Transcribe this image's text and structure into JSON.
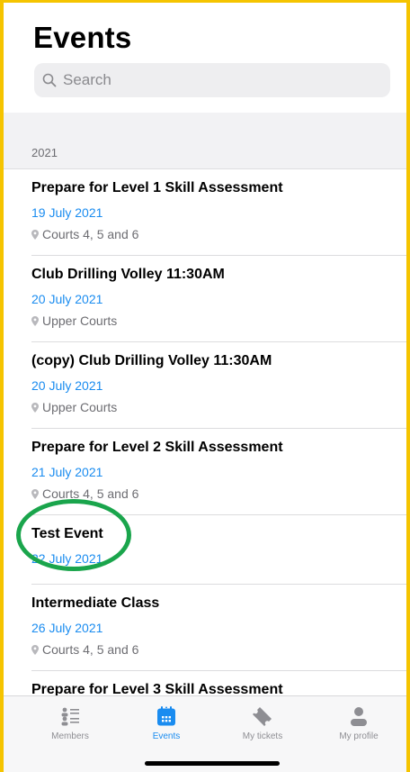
{
  "header": {
    "title": "Events",
    "search_placeholder": "Search"
  },
  "section": {
    "label": "2021"
  },
  "events": [
    {
      "title": "Prepare for Level 1 Skill Assessment",
      "date": "19 July 2021",
      "location": "Courts 4, 5 and 6"
    },
    {
      "title": "Club Drilling Volley 11:30AM",
      "date": "20 July 2021",
      "location": "Upper Courts"
    },
    {
      "title": "(copy) Club Drilling Volley 11:30AM",
      "date": "20 July 2021",
      "location": "Upper Courts"
    },
    {
      "title": "Prepare for Level 2 Skill Assessment",
      "date": "21 July 2021",
      "location": "Courts 4, 5 and 6"
    },
    {
      "title": "Test Event",
      "date": "22 July 2021"
    },
    {
      "title": "Intermediate Class",
      "date": "26 July 2021",
      "location": "Courts 4, 5 and 6"
    },
    {
      "title": "Prepare for Level 3 Skill Assessment"
    }
  ],
  "tabbar": {
    "tabs": [
      {
        "label": "Members",
        "icon": "members-icon"
      },
      {
        "label": "Events",
        "icon": "calendar-icon",
        "active": true
      },
      {
        "label": "My tickets",
        "icon": "ticket-icon"
      },
      {
        "label": "My profile",
        "icon": "person-icon"
      }
    ]
  },
  "colors": {
    "accent": "#1a8cf0",
    "frame_border": "#f5c400",
    "highlight_ring": "#1aa54c"
  }
}
